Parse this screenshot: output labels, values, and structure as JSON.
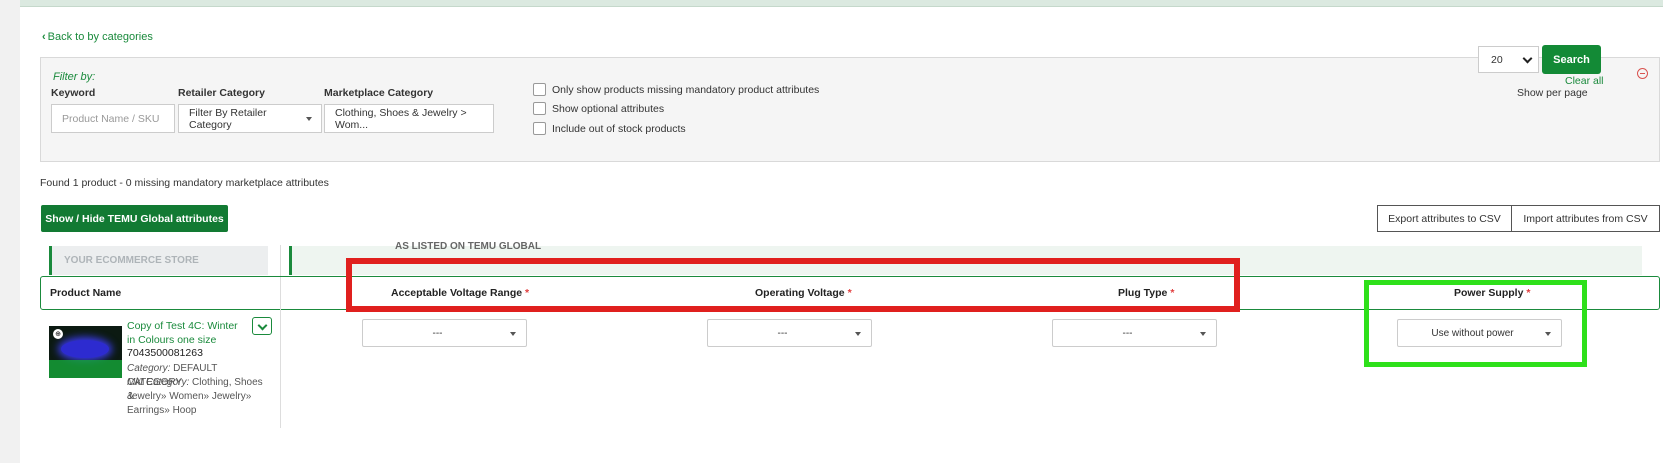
{
  "nav": {
    "back_label": "Back to by categories"
  },
  "filter": {
    "title": "Filter by:",
    "keyword_label": "Keyword",
    "keyword_placeholder": "Product Name / SKU",
    "retailer_label": "Retailer Category",
    "retailer_value": "Filter By Retailer Category",
    "marketplace_label": "Marketplace Category",
    "marketplace_value": "Clothing, Shoes & Jewelry > Wom...",
    "checkboxes": [
      {
        "label": "Only show products missing mandatory product attributes",
        "checked": false
      },
      {
        "label": "Show optional attributes",
        "checked": false
      },
      {
        "label": "Include out of stock products",
        "checked": false
      }
    ],
    "per_page_label": "Show per page",
    "per_page_value": "20",
    "search_label": "Search",
    "clear_label": "Clear all"
  },
  "results": {
    "found_text": "Found 1 product - 0 missing mandatory marketplace attributes",
    "toggle_label": "Show / Hide TEMU Global attributes",
    "export_label": "Export attributes to CSV",
    "import_label": "Import attributes from CSV"
  },
  "tabs": {
    "store": "YOUR ECOMMERCE STORE",
    "marketplace": "AS LISTED ON TEMU GLOBAL"
  },
  "columns": {
    "product_name": "Product Name",
    "attributes": [
      {
        "label": "Acceptable Voltage Range",
        "required": "*"
      },
      {
        "label": "Operating Voltage",
        "required": "*"
      },
      {
        "label": "Plug Type",
        "required": "*"
      },
      {
        "label": "Power Supply",
        "required": "*"
      }
    ]
  },
  "product": {
    "name": "Copy of Test 4C: Winter in Colours one size",
    "sku": "7043500081263",
    "category_label": "Category:",
    "category_value": "DEFAULT CATEGORY",
    "mkt_label": "Mkt Category:",
    "mkt_line1": "Clothing, Shoes &",
    "mkt_line2": "Jewelry» Women» Jewelry»",
    "mkt_line3": "Earrings» Hoop",
    "values": [
      "---",
      "---",
      "---",
      "Use without power"
    ]
  },
  "colors": {
    "accent": "#1a8a3c",
    "highlight_red": "#e0201e",
    "highlight_green": "#2ee01a"
  }
}
